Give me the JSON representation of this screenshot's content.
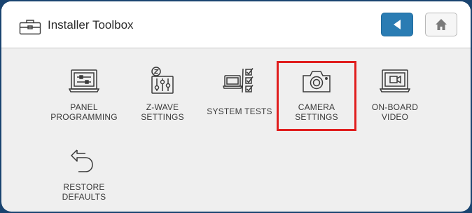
{
  "header": {
    "title": "Installer Toolbox",
    "icon": "toolbox-icon",
    "back_icon": "back-arrow-icon",
    "home_icon": "home-icon"
  },
  "tiles": [
    {
      "id": "panel-programming",
      "icon": "panel-programming-icon",
      "line1": "PANEL",
      "line2": "PROGRAMMING"
    },
    {
      "id": "z-wave-settings",
      "icon": "z-wave-settings-icon",
      "line1": "Z-WAVE",
      "line2": "SETTINGS"
    },
    {
      "id": "system-tests",
      "icon": "system-tests-icon",
      "line1": "SYSTEM TESTS",
      "line2": ""
    },
    {
      "id": "camera-settings",
      "icon": "camera-icon",
      "line1": "CAMERA",
      "line2": "SETTINGS"
    },
    {
      "id": "on-board-video",
      "icon": "on-board-video-icon",
      "line1": "ON-BOARD",
      "line2": "VIDEO"
    },
    {
      "id": "restore-defaults",
      "icon": "restore-icon",
      "line1": "RESTORE",
      "line2": "DEFAULTS"
    }
  ],
  "colors": {
    "frame_border": "#1a4470",
    "back_button": "#2a7cb3",
    "highlight": "#e01e1e"
  }
}
